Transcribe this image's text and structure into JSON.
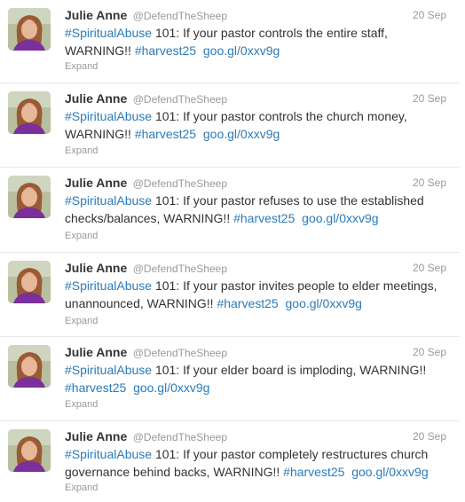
{
  "tweets": [
    {
      "name": "Julie Anne",
      "handle": "@DefendTheSheep",
      "date": "20 Sep",
      "hashtag1": "#SpiritualAbuse",
      "text": " 101: If your pastor controls the entire staff, WARNING!! ",
      "hashtag2": "#harvest25",
      "link": "goo.gl/0xxv9g",
      "expand": "Expand"
    },
    {
      "name": "Julie Anne",
      "handle": "@DefendTheSheep",
      "date": "20 Sep",
      "hashtag1": "#SpiritualAbuse",
      "text": " 101: If your pastor controls the church money, WARNING!! ",
      "hashtag2": "#harvest25",
      "link": "goo.gl/0xxv9g",
      "expand": "Expand"
    },
    {
      "name": "Julie Anne",
      "handle": "@DefendTheSheep",
      "date": "20 Sep",
      "hashtag1": "#SpiritualAbuse",
      "text": " 101: If your pastor refuses to use the established checks/balances, WARNING!! ",
      "hashtag2": "#harvest25",
      "link": "goo.gl/0xxv9g",
      "expand": "Expand"
    },
    {
      "name": "Julie Anne",
      "handle": "@DefendTheSheep",
      "date": "20 Sep",
      "hashtag1": "#SpiritualAbuse",
      "text": " 101: If your pastor invites people to elder meetings, unannounced, WARNING!! ",
      "hashtag2": "#harvest25",
      "link": "goo.gl/0xxv9g",
      "expand": "Expand"
    },
    {
      "name": "Julie Anne",
      "handle": "@DefendTheSheep",
      "date": "20 Sep",
      "hashtag1": "#SpiritualAbuse",
      "text": " 101: If your elder board is imploding, WARNING!! ",
      "hashtag2": "#harvest25",
      "link": "goo.gl/0xxv9g",
      "expand": "Expand"
    },
    {
      "name": "Julie Anne",
      "handle": "@DefendTheSheep",
      "date": "20 Sep",
      "hashtag1": "#SpiritualAbuse",
      "text": " 101: If your pastor completely restructures church governance behind backs, WARNING!! ",
      "hashtag2": "#harvest25",
      "link": "goo.gl/0xxv9g",
      "expand": "Expand"
    }
  ],
  "colors": {
    "link": "#2b7bb9",
    "muted": "#999999",
    "text": "#333333",
    "divider": "#e8e8e8"
  }
}
